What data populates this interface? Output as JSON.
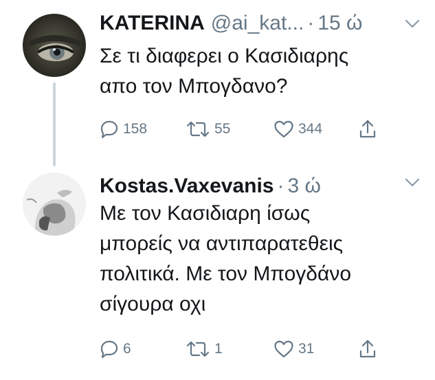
{
  "tweets": [
    {
      "name": "KATERINA",
      "handle": "@ai_kat...",
      "separator": "·",
      "time": "15 ώ",
      "lines": [
        "Σε τι διαφερει ο Κασιδιαρης",
        "απο τον Μπογδανο?"
      ],
      "replies": "158",
      "retweets": "55",
      "likes": "344"
    },
    {
      "name": "Kostas.Vaxevanis",
      "handle": "",
      "separator": "·",
      "time": "3 ώ",
      "lines": [
        "Με τον Κασιδιαρη ίσως",
        "μπορείς να αντιπαρατεθεις",
        "πολιτικά. Με τον Μπογδάνο",
        "σίγουρα οχι"
      ],
      "replies": "6",
      "retweets": "1",
      "likes": "31"
    }
  ],
  "colors": {
    "text": "#14171a",
    "secondary": "#657786",
    "thread_line": "#ccd6dd"
  },
  "icons": [
    "reply-icon",
    "retweet-icon",
    "like-icon",
    "share-icon",
    "chevron-down-icon"
  ]
}
